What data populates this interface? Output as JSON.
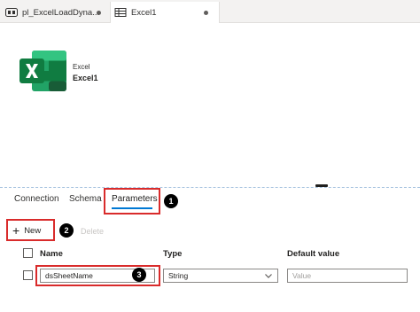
{
  "tabs": [
    {
      "label": "pl_ExcelLoadDyna...",
      "icon": "pipeline-icon",
      "modified": true
    },
    {
      "label": "Excel1",
      "icon": "dataset-icon",
      "modified": true
    }
  ],
  "dataset": {
    "type_label": "Excel",
    "name": "Excel1",
    "logo_icon": "excel-logo-icon"
  },
  "panel_tabs": [
    {
      "label": "Connection",
      "active": false
    },
    {
      "label": "Schema",
      "active": false
    },
    {
      "label": "Parameters",
      "active": true
    }
  ],
  "toolbar": {
    "new_label": "New",
    "delete_label": "Delete"
  },
  "table": {
    "columns": [
      "Name",
      "Type",
      "Default value"
    ],
    "rows": [
      {
        "name": "dsSheetName",
        "type": "String",
        "default_placeholder": "Value"
      }
    ]
  },
  "annotations": [
    "1",
    "2",
    "3"
  ],
  "colors": {
    "annotation_red": "#d92b2b",
    "accent_blue": "#0078d4",
    "excel_green": "#107c41"
  }
}
